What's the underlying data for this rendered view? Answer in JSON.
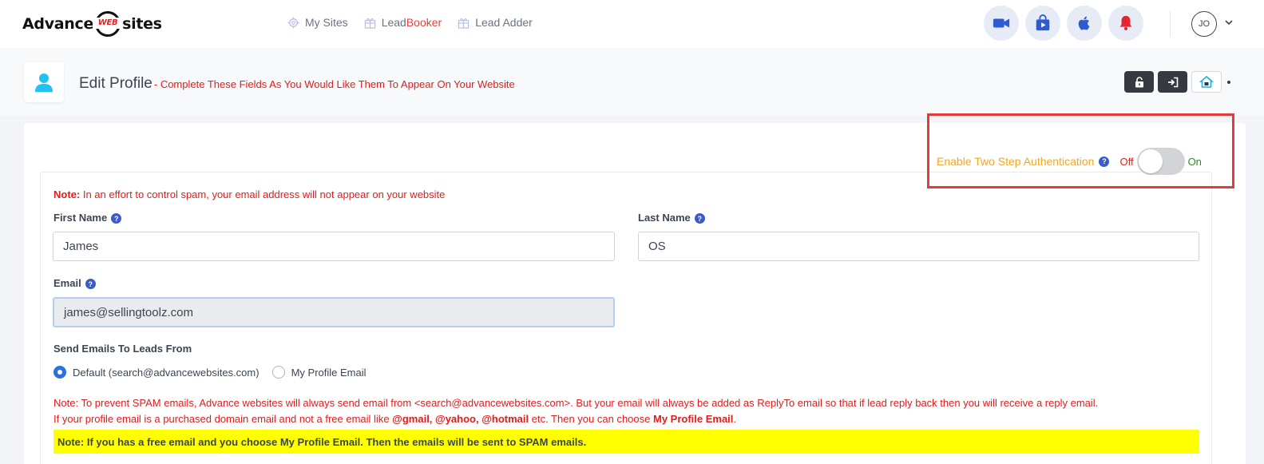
{
  "brand": {
    "logo_left": "Advance",
    "logo_mid": "WEB",
    "logo_right": "sites"
  },
  "nav": {
    "my_sites": "My Sites",
    "lead_booker_a": "Lead",
    "lead_booker_b": "Booker",
    "lead_adder": "Lead Adder"
  },
  "user": {
    "initials": "JO"
  },
  "header": {
    "title": "Edit Profile",
    "subtitle": "- Complete These Fields As You Would Like Them To Appear On Your Website"
  },
  "two_step": {
    "label": "Enable Two Step Authentication",
    "help": "?",
    "off": "Off",
    "on": "On",
    "enabled": false
  },
  "form": {
    "note_prefix": "Note:",
    "note_text": " In an effort to control spam, your email address will not appear on your website",
    "first_name_label": "First Name",
    "first_name_value": "James",
    "last_name_label": "Last Name",
    "last_name_value": "OS",
    "email_label": "Email",
    "email_value": "james@sellingtoolz.com",
    "send_from_label": "Send Emails To Leads From",
    "send_from_options": [
      "Default (search@advancewebsites.com)",
      "My Profile Email"
    ],
    "send_from_selected": "Default (search@advancewebsites.com)",
    "help": "?"
  },
  "notes": {
    "line1": "Note: To prevent SPAM emails, Advance websites will always send email from <search@advancewebsites.com>. But your email will always be added as ReplyTo email so that if lead reply back then you will receive a reply email.",
    "line2_a": "If your profile email is a purchased domain email and not a free email like ",
    "line2_b": "@gmail, @yahoo, @hotmail",
    "line2_c": " etc. Then you can choose ",
    "line2_d": "My Profile Email",
    "line2_e": ".",
    "yellow": "Note: If you has a free email and you choose My Profile Email. Then the emails will be sent to SPAM emails."
  },
  "colors": {
    "accent_red": "#e41b1b",
    "two_step_label": "#f5a623",
    "on_green": "#2e8b2e",
    "radio_blue": "#2b6fe0",
    "highlight_yellow": "#ffff00"
  }
}
